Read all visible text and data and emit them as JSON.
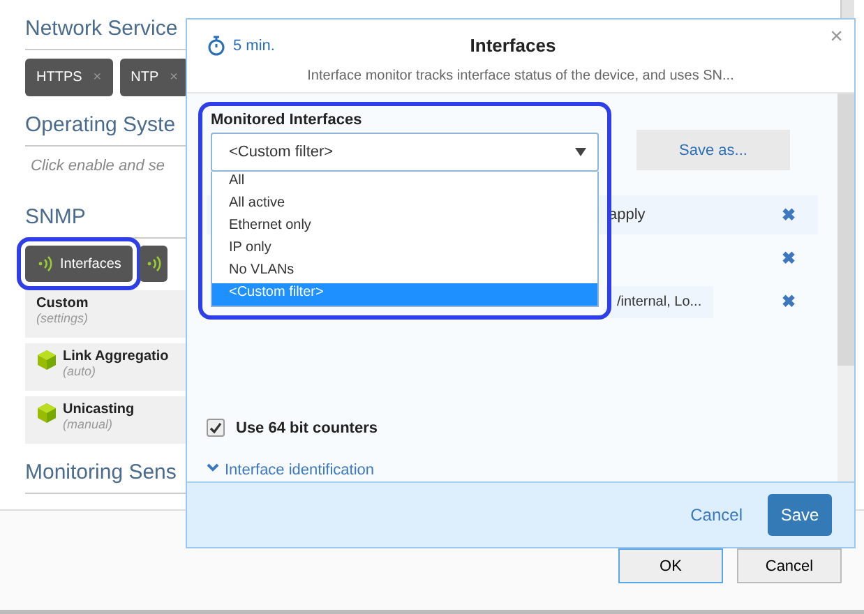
{
  "page": {
    "sections": [
      {
        "kind": "tags",
        "title": "Network Service",
        "tags": [
          {
            "label": "HTTPS",
            "remove": "×"
          },
          {
            "label": "NTP",
            "remove": "×"
          }
        ]
      },
      {
        "kind": "note",
        "title": "Operating Syste",
        "note": "Click enable and se"
      },
      {
        "kind": "snmp",
        "title": "SNMP",
        "buttons": [
          {
            "label": "Interfaces",
            "highlighted": true
          },
          {
            "highlighted": false
          }
        ],
        "cards": [
          {
            "title": "Custom",
            "subtitle": "(settings)",
            "icon": false
          },
          {
            "title": "Link Aggregatio",
            "subtitle": "(auto)",
            "icon": true
          },
          {
            "title": "Unicasting",
            "subtitle": "(manual)",
            "icon": true
          }
        ]
      },
      {
        "kind": "title_only",
        "title": "Monitoring Sens"
      }
    ],
    "buttons": [
      {
        "label": "OK",
        "primary": true
      },
      {
        "label": "Cancel",
        "primary": false
      }
    ]
  },
  "dialog": {
    "interval": "5 min.",
    "title": "Interfaces",
    "description": "Interface monitor tracks interface status of the device, and uses SN...",
    "close": "×",
    "monitored": {
      "label": "Monitored Interfaces",
      "highlighted": true,
      "value": "<Custom filter>",
      "expanded": true,
      "options": [
        {
          "label": "All",
          "selected": false
        },
        {
          "label": "All active",
          "selected": false
        },
        {
          "label": "Ethernet only",
          "selected": false
        },
        {
          "label": "IP only",
          "selected": false
        },
        {
          "label": "No VLANs",
          "selected": false
        },
        {
          "label": "<Custom filter>",
          "selected": true
        }
      ]
    },
    "save_as": "Save as...",
    "filters": [
      {
        "text": "apply",
        "remove": "✖"
      },
      {
        "remove": "✖"
      },
      {
        "value": "/internal, Lo...",
        "remove": "✖"
      }
    ],
    "use_64bit": {
      "label": "Use 64 bit counters",
      "checked": true
    },
    "section_link": "Interface identification",
    "buttons": [
      {
        "label": "Cancel",
        "primary": false
      },
      {
        "label": "Save",
        "primary": true
      }
    ]
  }
}
